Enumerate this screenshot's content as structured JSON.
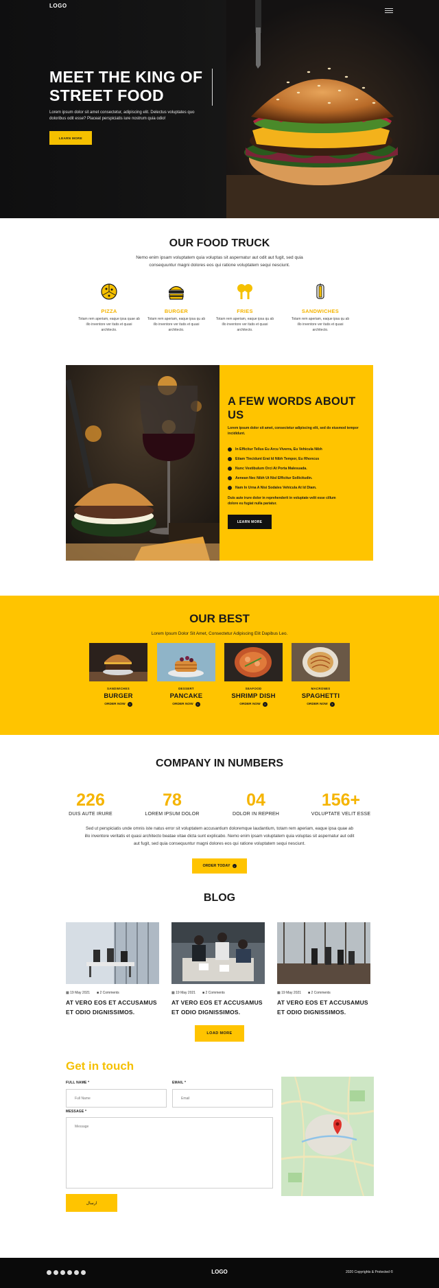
{
  "hero": {
    "logo": "LOGO",
    "title": "MEET THE KING OF STREET FOOD",
    "lead": "Lorem ipsum dolor sit amet consectetur, adipiscing elit. Delectus voluptates quo doloribus odit esse? Placeat perspiciatis iure nostrum quia odio!",
    "button": "LEARN MORE"
  },
  "truck": {
    "title": "OUR FOOD TRUCK",
    "text": "Nemo enim ipsam voluptatem quia voluptas sit aspernatur aut odit aut fugit, sed quia consequuntur magni dolores eos qui ratione voluptatem sequi nesciunt.",
    "features": [
      {
        "icon": "pizza-icon",
        "name": "PIZZA",
        "desc": "Totam rem aperiam, eaque ipsa quae ab illo inventore ver itatis et quasi architecto."
      },
      {
        "icon": "burger-icon",
        "name": "BURGER",
        "desc": "Totam rem aperiam, eaque ipsa qu ab illo inventore ver itatis et quasi architecto."
      },
      {
        "icon": "fries-icon",
        "name": "FRIES",
        "desc": "Totam rem aperiam, eaque ipsa qu ab illo inventore ver itatis et quasi architecto."
      },
      {
        "icon": "sandwich-icon",
        "name": "SANDWICHES",
        "desc": "Totam rem aperiam, eaque ipsa qu ab illo inventore ver itatis et quasi architecto."
      }
    ]
  },
  "about": {
    "title": "A FEW WORDS ABOUT US",
    "intro": "Lorem ipsum dolor sit amet, consectetur adipiscing elit, sed do eiusmod tempor incididunt.",
    "items": [
      "In Efficitur Tellus Eu Arcu Viverra, Eu Vehicula Nibh",
      "Etiam Tincidunt Erat Id Nibh Tempor, Eu Rhoncus",
      "Nunc Vestibulum Orci At Porta Malesuada.",
      "Aenean Nec Nibh Ut Nisl Efficitur Sollicitudin.",
      "Nam In Urna A Nisi Sodales Vehicula At Id Diam."
    ],
    "outro": "Duis aute irure dolor in reprehenderit in voluptate velit esse cillum dolore eu fugiat nulla pariatur.",
    "button": "LEARN MORE"
  },
  "best": {
    "title": "OUR BEST",
    "subtitle": "Lorem Ipsum Dolor Sit Amet, Consectetur Adipiscing Elit Dapibus Leo.",
    "order_label": "ORDER NOW",
    "dishes": [
      {
        "category": "SANDWICHES",
        "name": "BURGER"
      },
      {
        "category": "DESSERT",
        "name": "PANCAKE"
      },
      {
        "category": "SEAFOOD",
        "name": "SHRIMP DISH"
      },
      {
        "category": "MACRONES",
        "name": "SPAGHETTI"
      }
    ]
  },
  "numbers": {
    "title": "COMPANY IN NUMBERS",
    "stats": [
      {
        "value": "226",
        "label": "DUIS AUTE IRURE"
      },
      {
        "value": "78",
        "label": "LOREM IPSUM DOLOR"
      },
      {
        "value": "04",
        "label": "DOLOR IN REPREH"
      },
      {
        "value": "156+",
        "label": "VOLUPTATE VELIT ESSE"
      }
    ],
    "text": "Sed ut perspiciatis unde omnis iste natus error sit voluptatem accusantium doloremque laudantium, totam rem aperiam, eaque ipsa quae ab illo inventore veritatis et quasi architecto beatae vitae dicta sunt explicabo. Nemo enim ipsam voluptatem quia voluptas sit aspernatur aut odit aut fugit, sed quia consequuntur magni dolores eos qui ratione voluptatem sequi nesciunt.",
    "button": "ORDER TODAY"
  },
  "blog": {
    "title": "BLOG",
    "posts": [
      {
        "date": "19 May 2021",
        "comments": "2 Comments",
        "title": "AT VERO EOS ET ACCUSAMUS ET ODIO DIGNISSIMOS."
      },
      {
        "date": "19 May 2021",
        "comments": "2 Comments",
        "title": "AT VERO EOS ET ACCUSAMUS ET ODIO DIGNISSIMOS."
      },
      {
        "date": "19 May 2021",
        "comments": "2 Comments",
        "title": "AT VERO EOS ET ACCUSAMUS ET ODIO DIGNISSIMOS."
      }
    ],
    "button": "LOAD MORE"
  },
  "contact": {
    "title": "Get in touch",
    "name_label": "FULL NAME *",
    "name_placeholder": "Full Name",
    "email_label": "EMAIL *",
    "email_placeholder": "Email",
    "message_label": "MESSAGE *",
    "message_placeholder": "Message",
    "submit": "ارسال"
  },
  "footer": {
    "logo": "LOGO",
    "copyright": "2020 Copyrights & Protected ©",
    "socials": [
      "facebook-icon",
      "twitter-icon",
      "youtube-icon",
      "instagram-icon",
      "pinterest-icon",
      "behance-icon"
    ]
  },
  "colors": {
    "accent": "#ffc400",
    "dark": "#0a0a0a"
  }
}
